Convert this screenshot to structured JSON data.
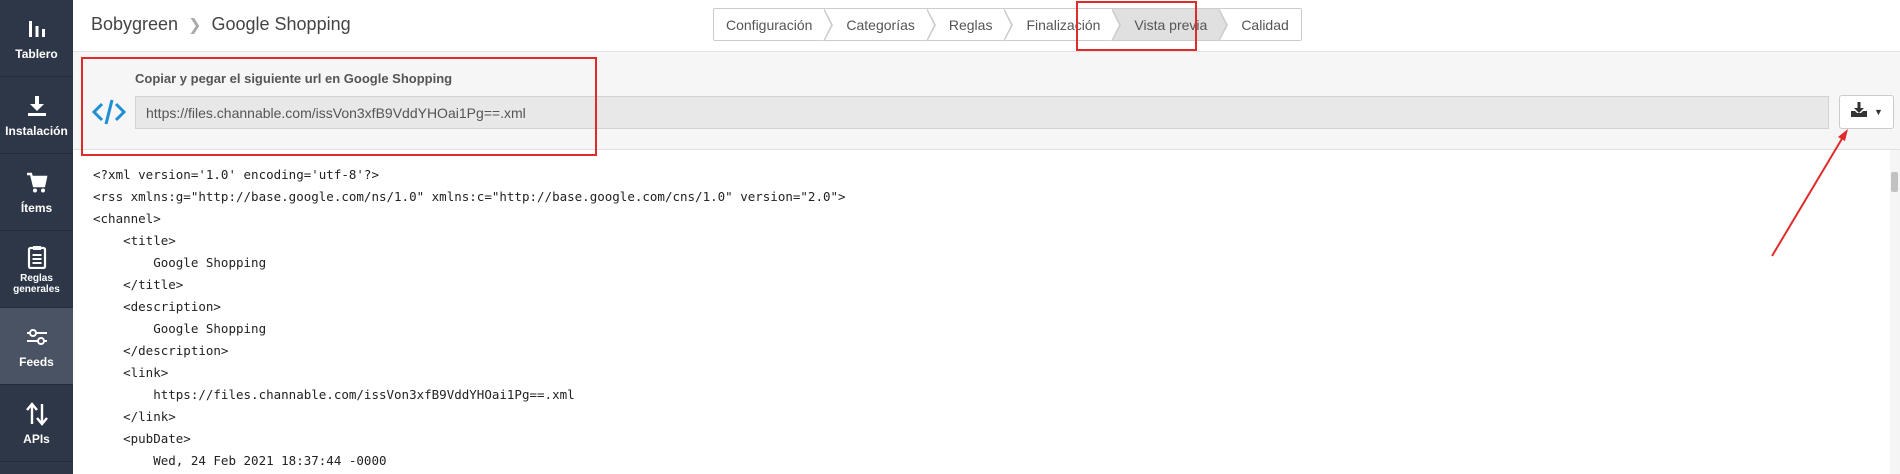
{
  "sidebar": {
    "items": [
      {
        "label": "Tablero",
        "icon": "bar-chart-icon"
      },
      {
        "label": "Instalación",
        "icon": "download-icon"
      },
      {
        "label": "Ítems",
        "icon": "cart-icon"
      },
      {
        "label": "Reglas generales",
        "icon": "clipboard-icon"
      },
      {
        "label": "Feeds",
        "icon": "sliders-icon"
      },
      {
        "label": "APIs",
        "icon": "up-down-arrows-icon"
      }
    ]
  },
  "header": {
    "breadcrumb": {
      "project": "Bobygreen",
      "page": "Google Shopping"
    },
    "steps": [
      "Configuración",
      "Categorías",
      "Reglas",
      "Finalización",
      "Vista previa",
      "Calidad"
    ],
    "active_step": "Vista previa"
  },
  "url_panel": {
    "caption": "Copiar y pegar el siguiente url en Google Shopping",
    "url": "https://files.channable.com/issVon3xfB9VddYHOai1Pg==.xml",
    "download_icon": "download-icon"
  },
  "xml_preview": {
    "lines": [
      "<?xml version='1.0' encoding='utf-8'?>",
      "<rss xmlns:g=\"http://base.google.com/ns/1.0\" xmlns:c=\"http://base.google.com/cns/1.0\" version=\"2.0\">",
      "<channel>",
      "    <title>",
      "        Google Shopping",
      "    </title>",
      "    <description>",
      "        Google Shopping",
      "    </description>",
      "    <link>",
      "        https://files.channable.com/issVon3xfB9VddYHOai1Pg==.xml",
      "    </link>",
      "    <pubDate>",
      "        Wed, 24 Feb 2021 18:37:44 -0000"
    ]
  },
  "colors": {
    "sidebar_bg": "#2d3747",
    "sidebar_active": "#4a5364",
    "accent_blue": "#1e8fd6",
    "annotation_red": "#e12a2a"
  }
}
